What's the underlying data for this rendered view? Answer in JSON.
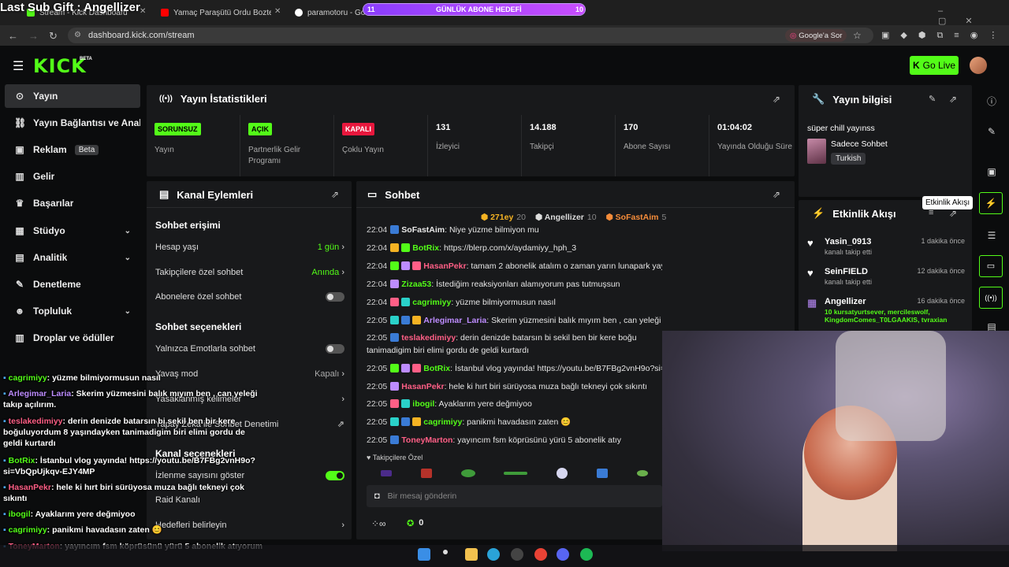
{
  "browser": {
    "tabs": [
      "Stream - Kick Dashboard",
      "Yamaç Paraşütü Ordu Boztepe - Yo",
      "paramotoru - Google"
    ],
    "url": "dashboard.kick.com/stream",
    "ask_google": "Google'a Sor"
  },
  "overlay": {
    "last_sub": "Last Sub Gift : Angellizer",
    "goal_left": "11",
    "goal_label": "GÜNLÜK ABONE HEDEFİ",
    "goal_right": "10",
    "progress": 1.0
  },
  "header": {
    "logo": "KICK",
    "logo_beta": "BETA",
    "go_live": "Go Live"
  },
  "sidebar": {
    "items": [
      {
        "label": "Yayın",
        "icon": "⊙"
      },
      {
        "label": "Yayın Bağlantısı ve Anahtarı",
        "icon": "⛓"
      },
      {
        "label": "Reklam",
        "icon": "▣",
        "badge": "Beta"
      },
      {
        "label": "Gelir",
        "icon": "▥"
      },
      {
        "label": "Başarılar",
        "icon": "♛"
      },
      {
        "label": "Stüdyo",
        "icon": "▦"
      },
      {
        "label": "Analitik",
        "icon": "▤"
      },
      {
        "label": "Denetleme",
        "icon": "✎"
      },
      {
        "label": "Topluluk",
        "icon": "☻"
      },
      {
        "label": "Droplar ve ödüller",
        "icon": "▥"
      }
    ]
  },
  "stats": {
    "title": "Yayın İstatistikleri",
    "cells": [
      {
        "badge": "SORUNSUZ",
        "label": "Yayın",
        "color": "#53fc18"
      },
      {
        "badge": "AÇIK",
        "label": "Partnerlik Gelir Programı",
        "color": "#53fc18"
      },
      {
        "badge": "KAPALI",
        "label": "Çoklu Yayın",
        "color": "#e8173d"
      },
      {
        "num": "131",
        "label": "İzleyici"
      },
      {
        "num": "14.188",
        "label": "Takipçi"
      },
      {
        "num": "170",
        "label": "Abone Sayısı"
      },
      {
        "num": "01:04:02",
        "label": "Yayında Olduğu Süre"
      }
    ]
  },
  "channel": {
    "title": "Kanal Eylemleri",
    "chat_access": "Sohbet erişimi",
    "account_age": "Hesap yaşı",
    "account_age_val": "1 gün",
    "followers_only": "Takipçilere özel sohbet",
    "followers_only_val": "Anında",
    "subs_only": "Abonelere özel sohbet",
    "chat_options": "Sohbet seçenekleri",
    "emotes_only": "Yalnızca Emotlarla sohbet",
    "slow_mode": "Yavaş mod",
    "slow_mode_val": "Kapalı",
    "banned_words": "Yasaklanmış kelimeler",
    "ai_mod": "Yapay Zeka ile Sohbet Denetimi",
    "channel_options": "Kanal seçenekleri",
    "viewer_count": "İzlenme sayısını göster",
    "raid": "Raid Kanalı",
    "goals": "Hedefleri belirleyin"
  },
  "chat": {
    "title": "Sohbet",
    "top": [
      {
        "name": "271ey",
        "count": "20",
        "color": "#f5b323"
      },
      {
        "name": "Angellizer",
        "count": "10",
        "color": "#dddddd"
      },
      {
        "name": "SoFastAim",
        "count": "5",
        "color": "#f58c3a"
      }
    ],
    "messages": [
      {
        "time": "22:04",
        "user": "SoFastAim",
        "color": "#e8e8e8",
        "text": "Niye yüzme bilmiyon mu"
      },
      {
        "time": "22:04",
        "user": "BotRix",
        "color": "#53fc18",
        "text": "https://blerp.com/x/aydamiyy_hph_3"
      },
      {
        "time": "22:04",
        "user": "HasanPekr",
        "color": "#ff5f86",
        "text": "tamam 2 abonelik atalım o zaman yarın lunapark yayını atlı karıncaya bin jsjsjsj"
      },
      {
        "time": "22:04",
        "user": "Zizaa53",
        "color": "#53fc18",
        "text": "İstediğim reaksiyonları alamıyorum pas tutmuşsun"
      },
      {
        "time": "22:04",
        "user": "cagrimiyy",
        "color": "#53fc18",
        "text": "yüzme bilmiyormusun nasıl"
      },
      {
        "time": "22:05",
        "user": "Arlegimar_Laria",
        "color": "#bd8cff",
        "text": "Skerim yüzmesini balık mıyım ben , can yeleği takıp açılırım."
      },
      {
        "time": "22:05",
        "user": "teslakedimiyy",
        "color": "#ff5f86",
        "text": "derin denizde batarsın bi sekil ben bir kere boğu"
      },
      {
        "time": "",
        "user": "",
        "color": "#e8e8e8",
        "text": "tanimadigim biri elimi gordu de geldi kurtardı"
      },
      {
        "time": "22:05",
        "user": "BotRix",
        "color": "#53fc18",
        "text": "İstanbul vlog yayında! https://youtu.be/B7FBg2vnH9o?si=V"
      },
      {
        "time": "22:05",
        "user": "HasanPekr",
        "color": "#ff5f86",
        "text": "hele ki hırt biri sürüyosa muza bağlı tekneyi çok sıkıntı"
      },
      {
        "time": "22:05",
        "user": "ibogil",
        "color": "#53fc18",
        "text": "Ayaklarım yere değmiyoo"
      },
      {
        "time": "22:05",
        "user": "cagrimiyy",
        "color": "#53fc18",
        "text": "panikmi havadasın zaten 😊"
      },
      {
        "time": "22:05",
        "user": "ToneyMarton",
        "color": "#ff5f86",
        "text": "yayıncım fsm köprüsünü yürü 5 abonelik atıy"
      }
    ],
    "followers_only": "Takipçilere Özel",
    "placeholder": "Bir mesaj gönderin",
    "points": "0"
  },
  "info": {
    "title": "Yayın bilgisi",
    "stream_title": "süper chill yayınss",
    "category": "Sadece Sohbet",
    "language": "Turkish"
  },
  "events": {
    "title": "Etkinlik Akışı",
    "tooltip": "Etkinlik Akışı",
    "items": [
      {
        "name": "Yasin_0913",
        "sub": "kanalı takip etti",
        "time": "1 dakika önce",
        "icon": "♥"
      },
      {
        "name": "SeinFIELD",
        "sub": "kanalı takip etti",
        "time": "12 dakika önce",
        "icon": "♥"
      },
      {
        "name": "Angellizer",
        "sub": "10 kursatyurtsever, mercileswolf, KingdomComes_T0LGAAKIS, tvraxian",
        "time": "16 dakika önce",
        "icon": "▦"
      }
    ]
  },
  "overlay_chat": [
    {
      "user": "cagrimiyy",
      "color": "#53fc18",
      "text": "yüzme bilmiyormusun nasıl"
    },
    {
      "user": "Arlegimar_Laria",
      "color": "#bd8cff",
      "text": "Skerim yüzmesini balık mıyım ben , can yeleği takıp açılırım."
    },
    {
      "user": "teslakedimiyy",
      "color": "#ff5f86",
      "text": "derin denizde batarsın bi sekil ben bir kere boğuluyordum 8 yaşındayken tanimadigim biri elimi gordu de geldi kurtardı"
    },
    {
      "user": "BotRix",
      "color": "#53fc18",
      "text": "İstanbul vlog yayında! https://youtu.be/B7FBg2vnH9o?si=VbQpUjkqv-EJY4MP"
    },
    {
      "user": "HasanPekr",
      "color": "#ff5f86",
      "text": "hele ki hırt biri sürüyosa muza bağlı tekneyi çok sıkıntı"
    },
    {
      "user": "ibogil",
      "color": "#53fc18",
      "text": "Ayaklarım yere değmiyoo"
    },
    {
      "user": "cagrimiyy",
      "color": "#53fc18",
      "text": "panikmi havadasın zaten 😊"
    },
    {
      "user": "ToneyMarton",
      "color": "#ff5f86",
      "text": "yayıncım fsm köprüsünü yürü 5 abonelik atıyorum"
    }
  ]
}
